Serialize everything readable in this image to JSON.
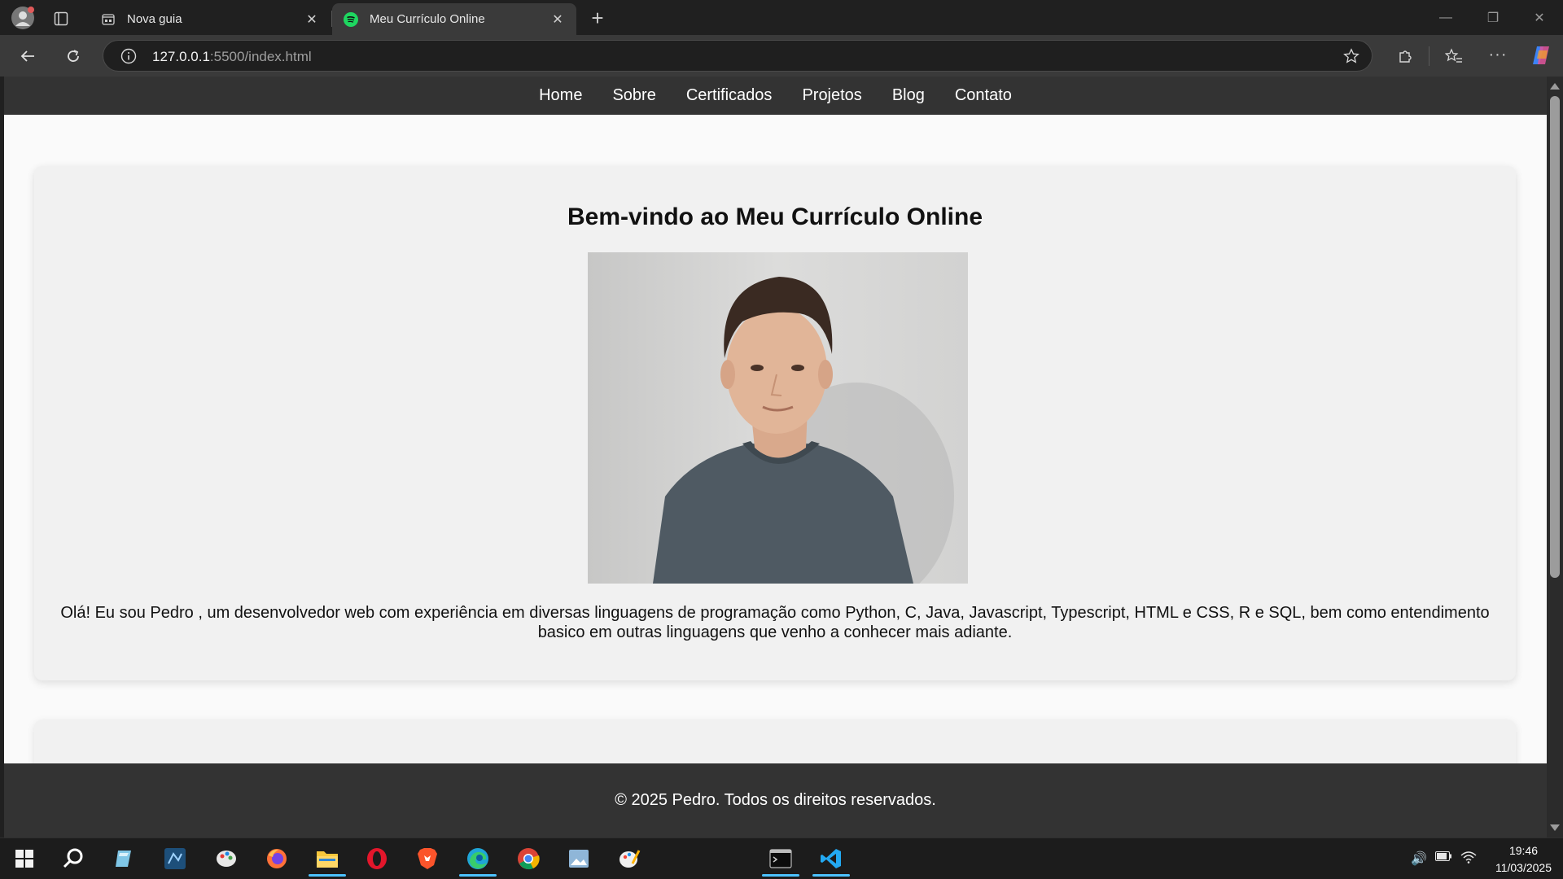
{
  "browser": {
    "tabs": [
      {
        "label": "Nova guia",
        "icon": "new-tab-page-icon"
      },
      {
        "label": "Meu Currículo Online",
        "icon": "spotify-icon"
      }
    ],
    "address": {
      "host": "127.0.0.1",
      "rest": ":5500/index.html"
    }
  },
  "site": {
    "nav": [
      "Home",
      "Sobre",
      "Certificados",
      "Projetos",
      "Blog",
      "Contato"
    ],
    "hero": {
      "title": "Bem-vindo ao Meu Currículo Online",
      "photo_alt": "profile-photo",
      "text": "Olá! Eu sou Pedro , um desenvolvedor web com experiência em diversas linguagens de programação como Python, C, Java, Javascript, Typescript, HTML e CSS, R e SQL, bem como entendimento basico em outras linguagens que venho a conhecer mais adiante."
    },
    "footer": "© 2025 Pedro. Todos os direitos reservados."
  },
  "taskbar": {
    "apps": [
      "start-icon",
      "search-icon",
      "notepad-icon",
      "dev-app-icon",
      "paint-icon",
      "firefox-icon",
      "file-explorer-icon",
      "opera-icon",
      "brave-icon",
      "edge-icon",
      "chrome-icon",
      "image-viewer-icon",
      "paint3d-icon",
      "terminal-icon",
      "vscode-icon"
    ],
    "time": "19:46",
    "date": "11/03/2025"
  },
  "colors": {
    "nav_bg": "#333333",
    "page_bg": "#fafafa",
    "card_bg": "#f1f1f1",
    "accent": "#4cc2ff"
  }
}
